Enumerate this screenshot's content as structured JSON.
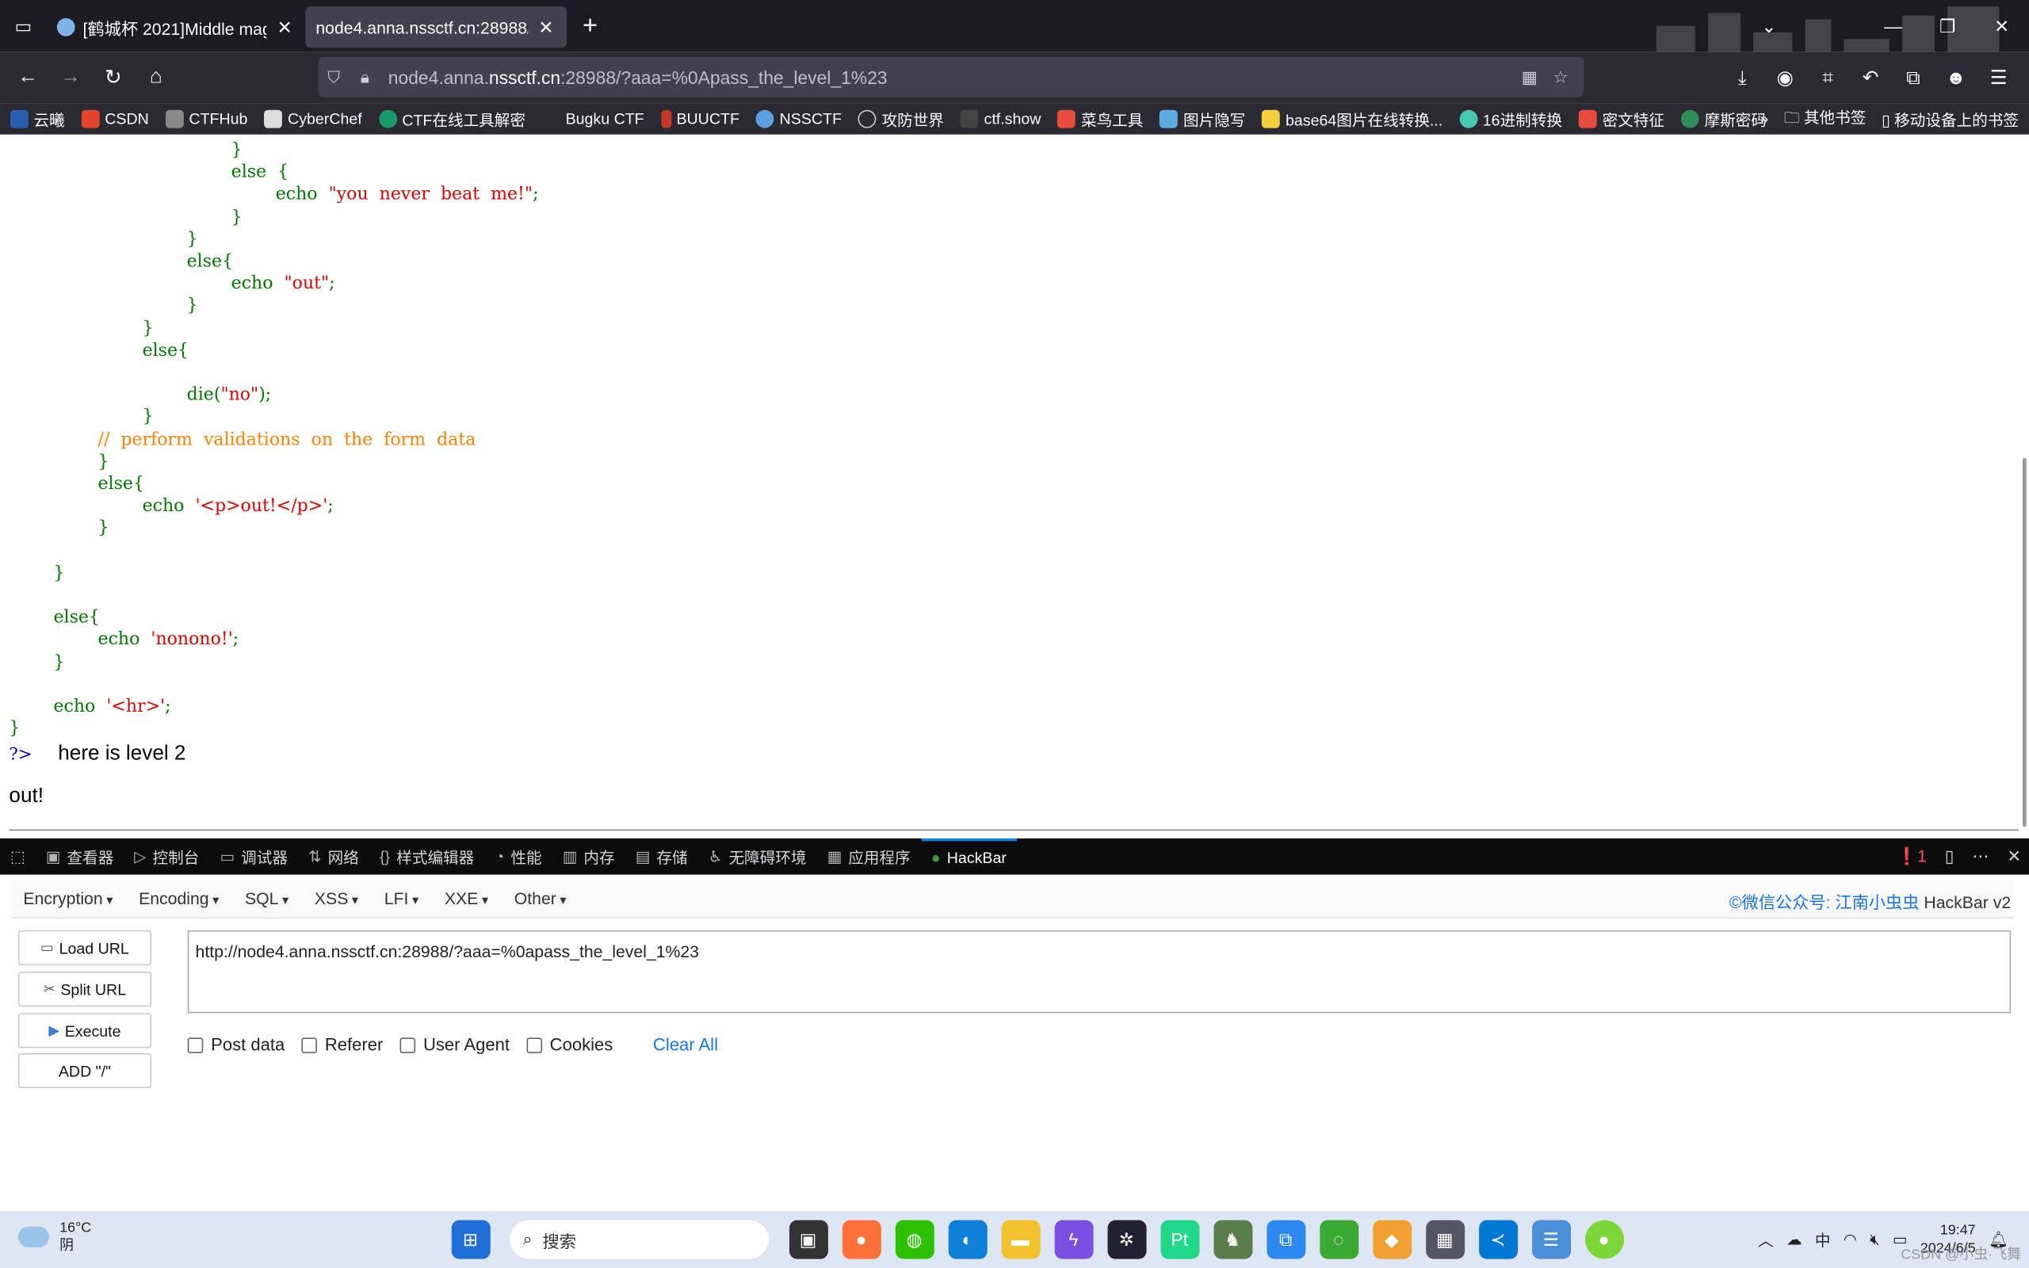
{
  "tabs": [
    {
      "title": "[鹤城杯 2021]Middle magic | N",
      "active": false
    },
    {
      "title": "node4.anna.nssctf.cn:28988/?aaa",
      "active": true
    }
  ],
  "address": {
    "prefix": "node4.anna.",
    "domain": "nssctf.cn",
    "rest": ":28988/?aaa=%0Apass_the_level_1%23"
  },
  "bookmarks": [
    {
      "label": "云曦",
      "color": "#2a5db0"
    },
    {
      "label": "CSDN",
      "color": "#e5442c"
    },
    {
      "label": "CTFHub",
      "color": "#888888"
    },
    {
      "label": "CyberChef",
      "color": "#dddddd"
    },
    {
      "label": "CTF在线工具解密",
      "color": "#1a9a6a"
    },
    {
      "label": "Bugku CTF",
      "color": "#2b2a33"
    },
    {
      "label": "BUUCTF",
      "color": "#c0392b"
    },
    {
      "label": "NSSCTF",
      "color": "#5aa0e0"
    },
    {
      "label": "攻防世界",
      "color": "#cccccc"
    },
    {
      "label": "ctf.show",
      "color": "#444444"
    },
    {
      "label": "菜鸟工具",
      "color": "#e74c3c"
    },
    {
      "label": "图片隐写",
      "color": "#5dade2"
    },
    {
      "label": "base64图片在线转换...",
      "color": "#f4d03f"
    },
    {
      "label": "16进制转换",
      "color": "#48c9b0"
    },
    {
      "label": "密文特征",
      "color": "#e74c3c"
    },
    {
      "label": "摩斯密码",
      "color": "#2e8b57"
    }
  ],
  "bookmarks_right": [
    "其他书签",
    "移动设备上的书签"
  ],
  "page": {
    "php_end": "?>",
    "level_text": "here is level 2",
    "out_text": "out!"
  },
  "devtools": {
    "tabs": [
      "查看器",
      "控制台",
      "调试器",
      "网络",
      "样式编辑器",
      "性能",
      "内存",
      "存储",
      "无障碍环境",
      "应用程序",
      "HackBar"
    ],
    "error_count": "1"
  },
  "hackbar": {
    "menus": [
      "Encryption",
      "Encoding",
      "SQL",
      "XSS",
      "LFI",
      "XXE",
      "Other"
    ],
    "credit_link": "©微信公众号: 江南小虫虫",
    "credit_tail": " HackBar v2",
    "buttons": [
      "Load URL",
      "Split URL",
      "Execute",
      "ADD \"/\""
    ],
    "url": "http://node4.anna.nssctf.cn:28988/?aaa=%0apass_the_level_1%23",
    "options": [
      "Post data",
      "Referer",
      "User Agent",
      "Cookies"
    ],
    "clear_all": "Clear All"
  },
  "taskbar": {
    "temperature": "16°C",
    "weather": "阴",
    "search": "搜索",
    "ime": "中",
    "time": "19:47",
    "date": "2024/6/5"
  },
  "watermark": "CSDN @小虫·飞舞"
}
